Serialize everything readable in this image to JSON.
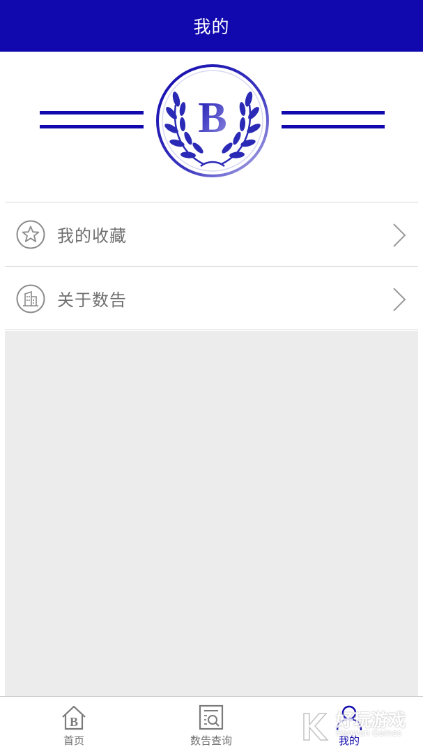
{
  "header": {
    "title": "我的"
  },
  "banner": {
    "logo_letter": "B"
  },
  "menu": {
    "items": [
      {
        "label": "我的收藏",
        "icon": "star-icon"
      },
      {
        "label": "关于数告",
        "icon": "building-icon"
      }
    ]
  },
  "tabbar": {
    "tabs": [
      {
        "label": "首页",
        "icon": "home-icon",
        "active": false
      },
      {
        "label": "数告查询",
        "icon": "search-document-icon",
        "active": false
      },
      {
        "label": "我的",
        "icon": "person-icon",
        "active": true
      }
    ]
  },
  "watermark": {
    "title": "好玩游戏",
    "subtitle": "Haowan Games"
  },
  "colors": {
    "brand": "#1109ad",
    "text_gray": "#6f6f6f",
    "content_bg": "#ececec"
  }
}
